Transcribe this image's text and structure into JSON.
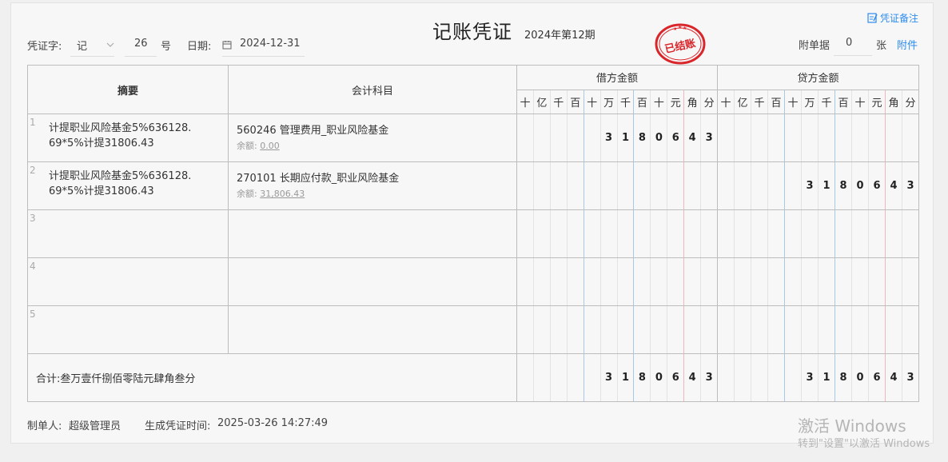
{
  "header": {
    "title": "记账凭证",
    "period": "2024年第12期",
    "note_link": "凭证备注",
    "voucher_word_label": "凭证字:",
    "voucher_word_value": "记",
    "voucher_number": "26",
    "number_suffix": "号",
    "date_label": "日期:",
    "date_value": "2024-12-31",
    "attach_label": "附单据",
    "attach_count": "0",
    "attach_unit": "张",
    "attach_link": "附件",
    "stamp_text": "已结账"
  },
  "table": {
    "col_summary": "摘要",
    "col_account": "会计科目",
    "col_debit": "借方金额",
    "col_credit": "贷方金额",
    "digit_units": [
      "十",
      "亿",
      "千",
      "百",
      "十",
      "万",
      "千",
      "百",
      "十",
      "元",
      "角",
      "分"
    ],
    "rows": [
      {
        "num": "1",
        "summary": "计提职业风险基金5%636128.69*5%计提31806.43",
        "account": "560246 管理费用_职业风险基金",
        "balance_label": "余额:",
        "balance": "0.00",
        "debit_digits": [
          "",
          "",
          "",
          "",
          "",
          "3",
          "1",
          "8",
          "0",
          "6",
          "4",
          "3"
        ],
        "credit_digits": [
          "",
          "",
          "",
          "",
          "",
          "",
          "",
          "",
          "",
          "",
          "",
          ""
        ]
      },
      {
        "num": "2",
        "summary": "计提职业风险基金5%636128.69*5%计提31806.43",
        "account": "270101 长期应付款_职业风险基金",
        "balance_label": "余额:",
        "balance": "31,806.43",
        "debit_digits": [
          "",
          "",
          "",
          "",
          "",
          "",
          "",
          "",
          "",
          "",
          "",
          ""
        ],
        "credit_digits": [
          "",
          "",
          "",
          "",
          "",
          "3",
          "1",
          "8",
          "0",
          "6",
          "4",
          "3"
        ]
      },
      {
        "num": "3",
        "summary": "",
        "account": "",
        "balance_label": "",
        "balance": "",
        "debit_digits": [
          "",
          "",
          "",
          "",
          "",
          "",
          "",
          "",
          "",
          "",
          "",
          ""
        ],
        "credit_digits": [
          "",
          "",
          "",
          "",
          "",
          "",
          "",
          "",
          "",
          "",
          "",
          ""
        ]
      },
      {
        "num": "4",
        "summary": "",
        "account": "",
        "balance_label": "",
        "balance": "",
        "debit_digits": [
          "",
          "",
          "",
          "",
          "",
          "",
          "",
          "",
          "",
          "",
          "",
          ""
        ],
        "credit_digits": [
          "",
          "",
          "",
          "",
          "",
          "",
          "",
          "",
          "",
          "",
          "",
          ""
        ]
      },
      {
        "num": "5",
        "summary": "",
        "account": "",
        "balance_label": "",
        "balance": "",
        "debit_digits": [
          "",
          "",
          "",
          "",
          "",
          "",
          "",
          "",
          "",
          "",
          "",
          ""
        ],
        "credit_digits": [
          "",
          "",
          "",
          "",
          "",
          "",
          "",
          "",
          "",
          "",
          "",
          ""
        ]
      }
    ],
    "total_label": "合计:叁万壹仟捌佰零陆元肆角叁分",
    "total_debit_digits": [
      "",
      "",
      "",
      "",
      "",
      "3",
      "1",
      "8",
      "0",
      "6",
      "4",
      "3"
    ],
    "total_credit_digits": [
      "",
      "",
      "",
      "",
      "",
      "3",
      "1",
      "8",
      "0",
      "6",
      "4",
      "3"
    ]
  },
  "footer": {
    "maker_label": "制单人:",
    "maker": "超级管理员",
    "time_label": "生成凭证时间:",
    "time": "2025-03-26 14:27:49"
  },
  "watermark": {
    "line1": "激活 Windows",
    "line2": "转到\"设置\"以激活 Windows"
  },
  "colors": {
    "accent": "#2d8cf0",
    "stamp": "#d9262b"
  }
}
